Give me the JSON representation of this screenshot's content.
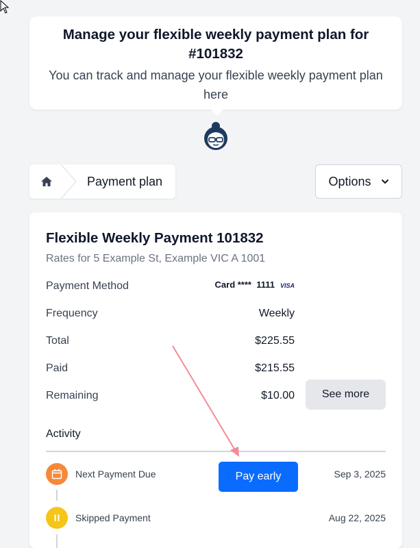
{
  "header": {
    "title": "Manage your flexible weekly payment plan for #101832",
    "subtitle": "You can track and manage your flexible weekly payment plan here"
  },
  "breadcrumb": {
    "current": "Payment plan"
  },
  "options_button": {
    "label": "Options"
  },
  "plan": {
    "title": "Flexible Weekly Payment 101832",
    "subtitle": "Rates for 5 Example St, Example VIC A 1001",
    "rows": [
      {
        "label": "Payment Method",
        "value": "Card ****  1111",
        "badge": "VISA"
      },
      {
        "label": "Frequency",
        "value": "Weekly"
      },
      {
        "label": "Total",
        "value": "$225.55"
      },
      {
        "label": "Paid",
        "value": "$215.55"
      },
      {
        "label": "Remaining",
        "value": "$10.00"
      }
    ],
    "see_more_label": "See more"
  },
  "activity": {
    "title": "Activity",
    "items": [
      {
        "label": "Next Payment Due",
        "date": "Sep 3, 2025",
        "icon": "calendar-icon",
        "color": "#f5893a"
      },
      {
        "label": "Skipped Payment",
        "date": "Aug 22, 2025",
        "icon": "pause-icon",
        "color": "#f5c518"
      }
    ],
    "pay_early_label": "Pay early"
  },
  "colors": {
    "primary": "#0a6cff",
    "annotation_arrow": "#f28b96"
  }
}
